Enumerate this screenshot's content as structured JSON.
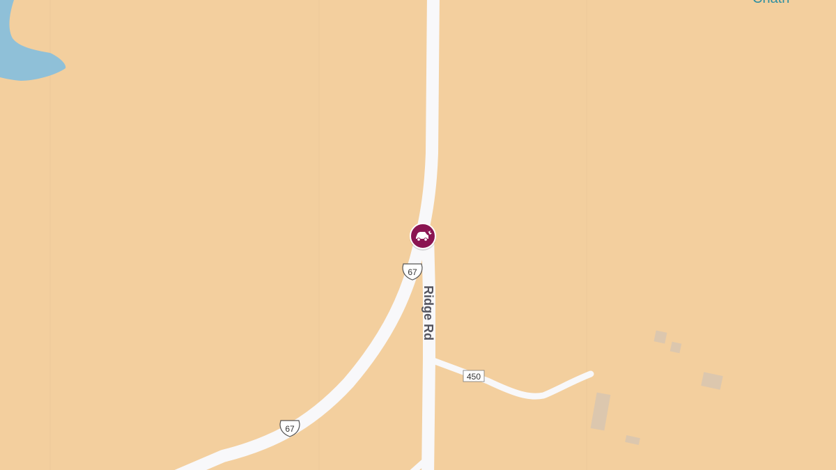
{
  "map": {
    "colors": {
      "land": "#f3cf9e",
      "water": "#8fc0d8",
      "road": "#f8f8fa",
      "building": "#dcc7ae",
      "poi": "#8a1552",
      "place_label": "#2f8fa0"
    },
    "roads": {
      "us_route_number": "67",
      "ridge_rd_label": "Ridge Rd",
      "county_road_number": "450"
    },
    "poi": {
      "icon": "car-crash-icon"
    },
    "place_label_partial": "Chath"
  }
}
